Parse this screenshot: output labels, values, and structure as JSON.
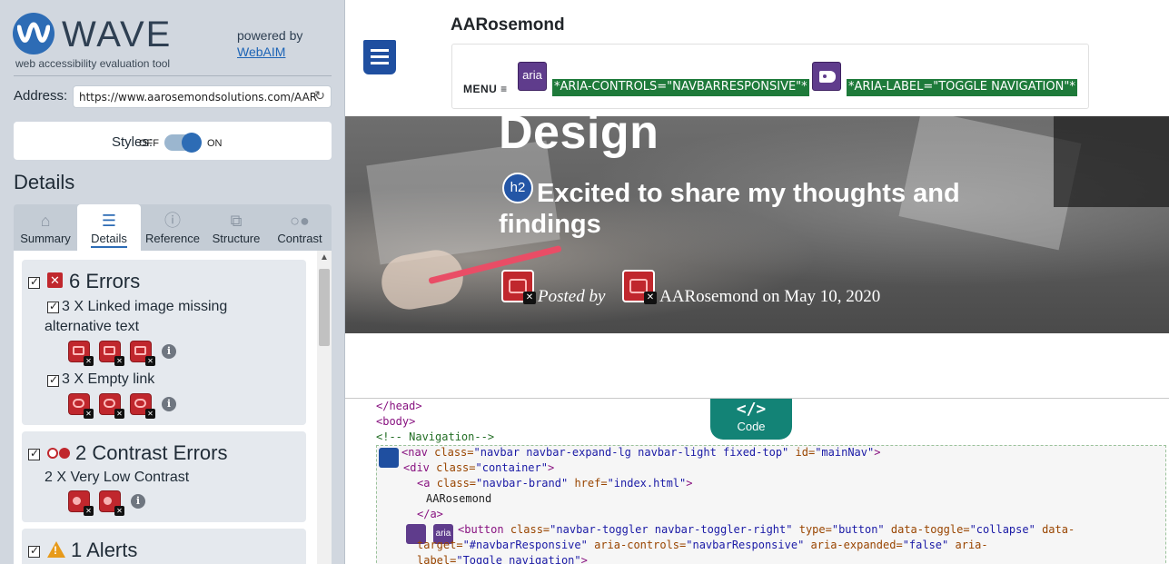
{
  "wave": {
    "title": "WAVE",
    "subtitle": "web accessibility evaluation tool",
    "powered_by": "powered by",
    "webaim": "WebAIM",
    "address_label": "Address:",
    "address_value": "https://www.aarosemondsolutions.com/AAR",
    "styles_label": "Styles:",
    "off": "OFF",
    "on": "ON",
    "details_heading": "Details",
    "tabs": [
      {
        "label": "Summary",
        "icon": "home-icon"
      },
      {
        "label": "Details",
        "icon": "list-icon"
      },
      {
        "label": "Reference",
        "icon": "info-icon"
      },
      {
        "label": "Structure",
        "icon": "structure-icon"
      },
      {
        "label": "Contrast",
        "icon": "contrast-icon"
      }
    ],
    "active_tab": "Details",
    "categories": {
      "errors": {
        "title": "6 Errors",
        "items": [
          {
            "text": "3 X Linked image missing alternative text"
          },
          {
            "text": "3 X Empty link"
          }
        ]
      },
      "contrast": {
        "title": "2 Contrast Errors",
        "items": [
          {
            "text": "2 X Very Low Contrast"
          }
        ]
      },
      "alerts": {
        "title": "1 Alerts"
      }
    }
  },
  "site": {
    "brand": "AARosemond",
    "menu": "MENU ≡",
    "aria_controls": "*ARIA-CONTROLS=\"NAVBARRESPONSIVE\"*",
    "aria_label": "*ARIA-LABEL=\"TOGGLE NAVIGATION\"*",
    "aria_icon": "aria",
    "hero_title": "Design",
    "h2_badge": "h2",
    "hero_subtitle": "Excited to share my thoughts and findings",
    "posted_by": "Posted by",
    "author_line": "AARosemond on May 10, 2020"
  },
  "code": {
    "tab_symbol": "</>",
    "tab_label": "Code",
    "lines": {
      "l1": "</head>",
      "l2": "<body>",
      "l3": "<!-- Navigation-->",
      "nav_open": "<nav",
      "nav_class_attr": "class=",
      "nav_class_val": "\"navbar navbar-expand-lg navbar-light fixed-top\"",
      "nav_id_attr": "id=",
      "nav_id_val": "\"mainNav\"",
      "nav_close": ">",
      "div_open": "<div",
      "div_class_attr": "class=",
      "div_class_val": "\"container\"",
      "div_close": ">",
      "a_open": "<a",
      "a_class_attr": "class=",
      "a_class_val": "\"navbar-brand\"",
      "a_href_attr": "href=",
      "a_href_val": "\"index.html\"",
      "a_close": ">",
      "brand_text": "AARosemond",
      "a_end": "</a>",
      "btn_open": "<button",
      "btn_class_attr": "class=",
      "btn_class_val": "\"navbar-toggler navbar-toggler-right\"",
      "btn_type_attr": "type=",
      "btn_type_val": "\"button\"",
      "btn_toggle_attr": "data-toggle=",
      "btn_toggle_val": "\"collapse\"",
      "btn_data_attr": "data-",
      "btn_target_attr": "target=",
      "btn_target_val": "\"#navbarResponsive\"",
      "btn_controls_attr": "aria-controls=",
      "btn_controls_val": "\"navbarResponsive\"",
      "btn_expanded_attr": "aria-expanded=",
      "btn_expanded_val": "\"false\"",
      "btn_aria_attr": "aria-",
      "btn_label_attr": "label=",
      "btn_label_val": "\"Toggle navigation\"",
      "btn_close": ">"
    }
  },
  "colors": {
    "wave_blue": "#2d6cb5",
    "error_red": "#c0272d",
    "aria_purple": "#5f3c8c",
    "aria_green": "#1e7a3a",
    "code_teal": "#138376"
  }
}
